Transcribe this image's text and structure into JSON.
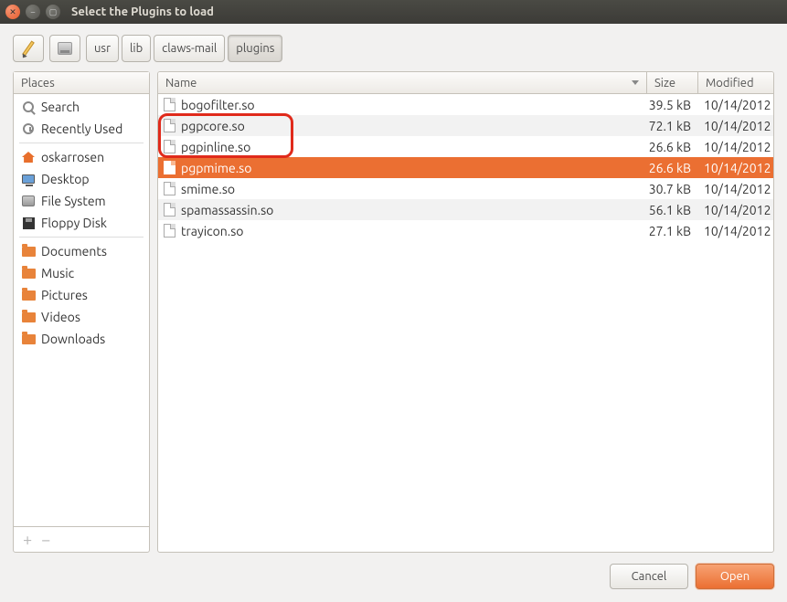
{
  "window": {
    "title": "Select the Plugins to load"
  },
  "pathbar": {
    "crumbs": [
      "usr",
      "lib",
      "claws-mail",
      "plugins"
    ],
    "active_index": 3
  },
  "sidebar": {
    "header": "Places",
    "groups": [
      [
        {
          "icon": "magnifier-icon",
          "label": "Search"
        },
        {
          "icon": "clock-icon",
          "label": "Recently Used"
        }
      ],
      [
        {
          "icon": "home-icon",
          "label": "oskarrosen"
        },
        {
          "icon": "monitor-icon",
          "label": "Desktop"
        },
        {
          "icon": "drive-icon",
          "label": "File System"
        },
        {
          "icon": "floppy-icon",
          "label": "Floppy Disk"
        }
      ],
      [
        {
          "icon": "folder-icon",
          "label": "Documents"
        },
        {
          "icon": "folder-icon",
          "label": "Music"
        },
        {
          "icon": "folder-icon",
          "label": "Pictures"
        },
        {
          "icon": "folder-icon",
          "label": "Videos"
        },
        {
          "icon": "folder-icon",
          "label": "Downloads"
        }
      ]
    ]
  },
  "filelist": {
    "columns": {
      "name": "Name",
      "size": "Size",
      "modified": "Modified"
    },
    "rows": [
      {
        "name": "bogofilter.so",
        "size": "39.5 kB",
        "modified": "10/14/2012",
        "selected": false
      },
      {
        "name": "pgpcore.so",
        "size": "72.1 kB",
        "modified": "10/14/2012",
        "selected": false
      },
      {
        "name": "pgpinline.so",
        "size": "26.6 kB",
        "modified": "10/14/2012",
        "selected": false
      },
      {
        "name": "pgpmime.so",
        "size": "26.6 kB",
        "modified": "10/14/2012",
        "selected": true
      },
      {
        "name": "smime.so",
        "size": "30.7 kB",
        "modified": "10/14/2012",
        "selected": false
      },
      {
        "name": "spamassassin.so",
        "size": "56.1 kB",
        "modified": "10/14/2012",
        "selected": false
      },
      {
        "name": "trayicon.so",
        "size": "27.1 kB",
        "modified": "10/14/2012",
        "selected": false
      }
    ]
  },
  "buttons": {
    "cancel": "Cancel",
    "open": "Open"
  }
}
